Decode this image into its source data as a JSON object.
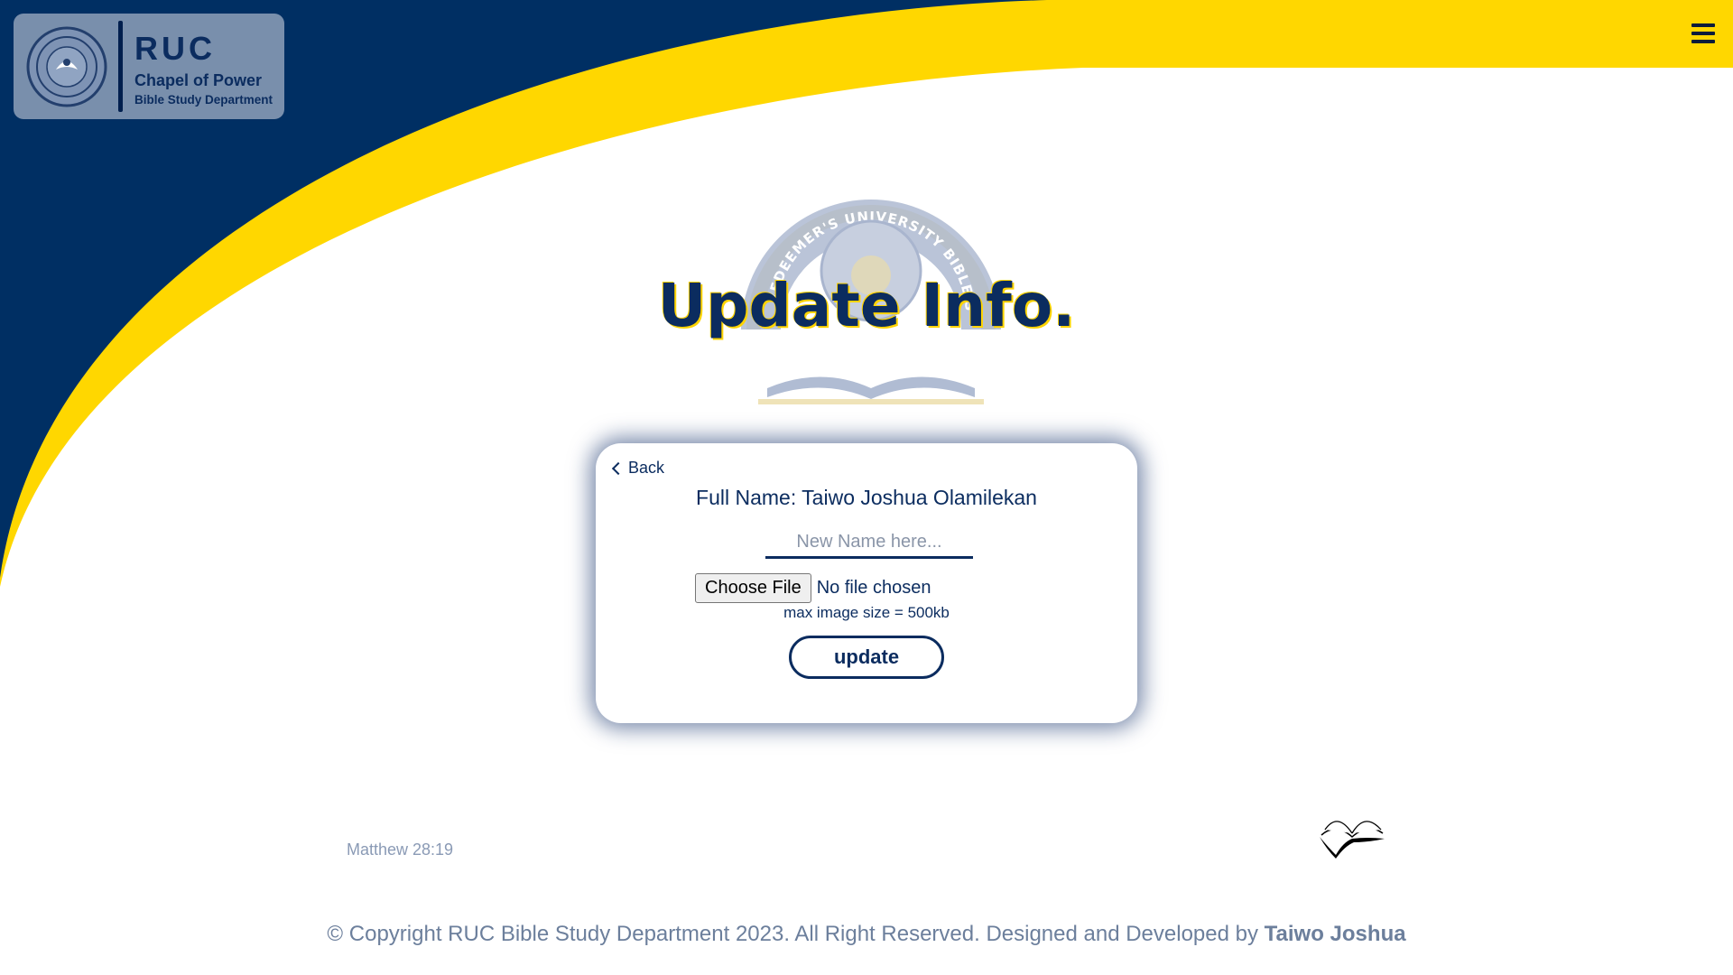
{
  "brand": {
    "title": "RUC",
    "subtitle": "Chapel of Power",
    "department": "Bible Study Department",
    "seal_icon": "university-seal-icon"
  },
  "header": {
    "menu_icon": "hamburger-menu-icon"
  },
  "hero": {
    "title": "Update Info.",
    "emblem_text": "REDEEMER'S UNIVERSITY BIBLE STUDY UNIT"
  },
  "form": {
    "back_label": "Back",
    "full_name": "Full Name: Taiwo Joshua Olamilekan",
    "name_placeholder": "New Name here...",
    "file_button_label": "Choose File",
    "file_status": "No file chosen",
    "max_size_note": "max image size = 500kb",
    "submit_label": "update"
  },
  "decor": {
    "verse_reference": "Matthew 28:19",
    "bible_icon": "open-bible-icon"
  },
  "footer": {
    "copyright": "© Copyright RUC Bible Study Department 2023. All Right Reserved. Designed and Developed by ",
    "author": "Taiwo Joshua"
  },
  "colors": {
    "navy": "#002f63",
    "yellow": "#ffd700",
    "text_navy": "#0b2c5f"
  }
}
